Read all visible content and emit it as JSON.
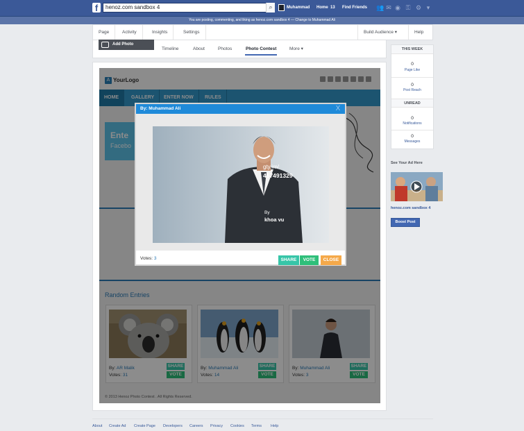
{
  "topbar": {
    "logo": "f",
    "search_value": "henoz.com sandbox 4",
    "profile": "Muhammad",
    "home": "Home",
    "home_count": "13",
    "find_friends": "Find Friends"
  },
  "banner": "You are posting, commenting, and liking as henoz.com sandbox 4 — Change to Muhammad Ali",
  "page_tabs": {
    "page": "Page",
    "activity": "Activity",
    "insights": "Insights",
    "settings": "Settings",
    "build": "Build Audience ▾",
    "help": "Help ▾"
  },
  "cover": {
    "add_photo": "Add Photo"
  },
  "sub_tabs": {
    "timeline": "Timeline",
    "about": "About",
    "photos": "Photos",
    "contest": "Photo Contest",
    "more": "More ▾"
  },
  "app": {
    "logo": "YourLogo",
    "nav": {
      "home": "HOME",
      "gallery": "GALLERY",
      "enter": "ENTER NOW",
      "rules": "RULES"
    },
    "hero_line1": "Ente",
    "hero_line2": "Facebo",
    "random_title": "Random Entries",
    "footer": "© 2013 Henoz Photo Contest . All Rights Reserved.",
    "share_label": "SHARE",
    "vote_label": "VOTE",
    "votes_label": "Votes:",
    "by_label": "By:",
    "entries": [
      {
        "author": "AR Malik",
        "votes": "31"
      },
      {
        "author": "Muhammad Ali",
        "votes": "14"
      },
      {
        "author": "Muhammad Ali",
        "votes": "3"
      }
    ]
  },
  "modal": {
    "header": "By: Muhammad Ali",
    "close_x": "X",
    "votes_label": "Votes:",
    "votes": "3",
    "share": "SHARE",
    "vote": "VOTE",
    "close": "CLOSE",
    "wm1": "gty.im/",
    "wm2": "467491329",
    "wm3": "By",
    "wm4": "khoa vu"
  },
  "right": {
    "this_week": "THIS WEEK",
    "likes_num": "0",
    "likes_lbl": "Page Like",
    "reach_num": "0",
    "reach_lbl": "Post Reach",
    "unread": "UNREAD",
    "notif_num": "0",
    "notif_lbl": "Notifications",
    "msg_num": "0",
    "msg_lbl": "Messages",
    "ad_title": "See Your Ad Here",
    "ad_name": "henoz.com sandbox 4",
    "boost": "Boost Post"
  },
  "footer_links": [
    "About",
    "Create Ad",
    "Create Page",
    "Developers",
    "Careers",
    "Privacy",
    "Cookies",
    "Terms",
    "Help"
  ],
  "colors": {
    "facebook_blue": "#3b5998",
    "app_nav": "#3399cc",
    "modal_head": "#1f8ad9",
    "share": "#37c5a8",
    "vote": "#2fbf7a",
    "close": "#f5a94a"
  }
}
